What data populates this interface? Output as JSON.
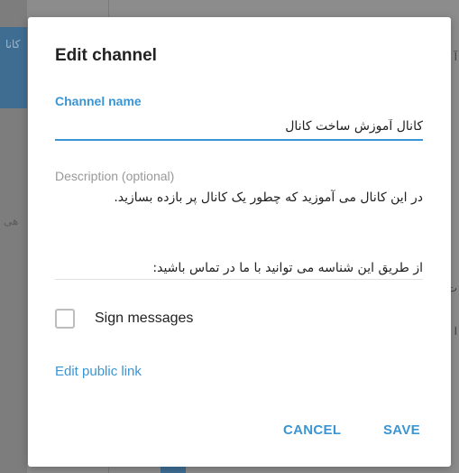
{
  "background": {
    "left_top_text": "کانا",
    "left_mid_text": "هی",
    "right_texts": [
      "آ",
      "ت",
      "ا"
    ]
  },
  "dialog": {
    "title": "Edit channel",
    "channel_name": {
      "label": "Channel name",
      "value": "کانال آموزش ساخت کانال"
    },
    "description": {
      "label": "Description (optional)",
      "line1": "در این کانال می آموزید که چطور یک کانال پر بازده بسازید.",
      "line2": "از طریق این شناسه می توانید با ما در تماس باشید:"
    },
    "sign_messages": {
      "label": "Sign messages",
      "checked": false
    },
    "edit_public_link": "Edit public link",
    "buttons": {
      "cancel": "CANCEL",
      "save": "SAVE"
    }
  },
  "colors": {
    "accent": "#3a95d5",
    "overlay": "#8c8c8c"
  }
}
